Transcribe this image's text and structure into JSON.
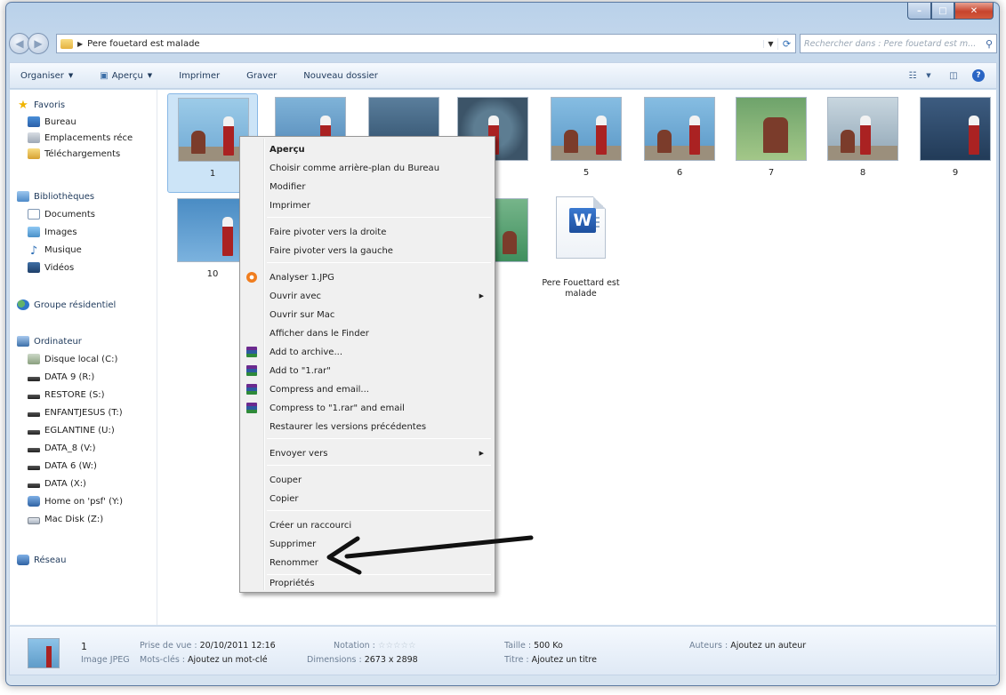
{
  "window": {
    "title_path": "Pere fouetard est malade",
    "search_placeholder": "Rechercher dans : Pere fouetard est m...",
    "controls": {
      "minimize_icon": "minimize-icon",
      "maximize_icon": "maximize-icon",
      "close_icon": "close-icon"
    }
  },
  "toolbar": {
    "organize": "Organiser",
    "preview": "Aperçu",
    "print": "Imprimer",
    "burn": "Graver",
    "new_folder": "Nouveau dossier"
  },
  "nav": {
    "favorites": "Favoris",
    "desktop": "Bureau",
    "recent_places": "Emplacements réce",
    "downloads": "Téléchargements",
    "libraries": "Bibliothèques",
    "documents": "Documents",
    "images": "Images",
    "music": "Musique",
    "videos": "Vidéos",
    "homegroup": "Groupe résidentiel",
    "computer": "Ordinateur",
    "drives": [
      "Disque local (C:)",
      "DATA 9 (R:)",
      "RESTORE (S:)",
      "ENFANTJESUS (T:)",
      "EGLANTINE (U:)",
      "DATA_8 (V:)",
      "DATA 6 (W:)",
      "DATA (X:)",
      "Home on 'psf' (Y:)",
      "Mac Disk (Z:)"
    ],
    "network": "Réseau"
  },
  "files": {
    "thumbs": [
      "1",
      "5",
      "6",
      "7",
      "8",
      "9",
      "10"
    ],
    "word_doc": "Pere Fouettard est malade"
  },
  "context_menu": {
    "items": [
      "Aperçu",
      "Choisir comme arrière-plan du Bureau",
      "Modifier",
      "Imprimer",
      "Faire pivoter vers la droite",
      "Faire pivoter vers la gauche",
      "Analyser 1.JPG",
      "Ouvrir avec",
      "Ouvrir sur Mac",
      "Afficher dans le Finder",
      "Add to archive...",
      "Add to \"1.rar\"",
      "Compress and email...",
      "Compress to \"1.rar\" and email",
      "Restaurer les versions précédentes",
      "Envoyer vers",
      "Couper",
      "Copier",
      "Créer un raccourci",
      "Supprimer",
      "Renommer",
      "Propriétés"
    ]
  },
  "details": {
    "name": "1",
    "type": "Image JPEG",
    "date_taken_label": "Prise de vue :",
    "date_taken": "20/10/2011 12:16",
    "keywords_label": "Mots-clés :",
    "keywords": "Ajoutez un mot-clé",
    "rating_label": "Notation :",
    "rating_stars": "☆☆☆☆☆",
    "dimensions_label": "Dimensions :",
    "dimensions": "2673 x 2898",
    "size_label": "Taille :",
    "size": "500 Ko",
    "title_label": "Titre :",
    "title": "Ajoutez un titre",
    "authors_label": "Auteurs :",
    "authors": "Ajoutez un auteur"
  }
}
